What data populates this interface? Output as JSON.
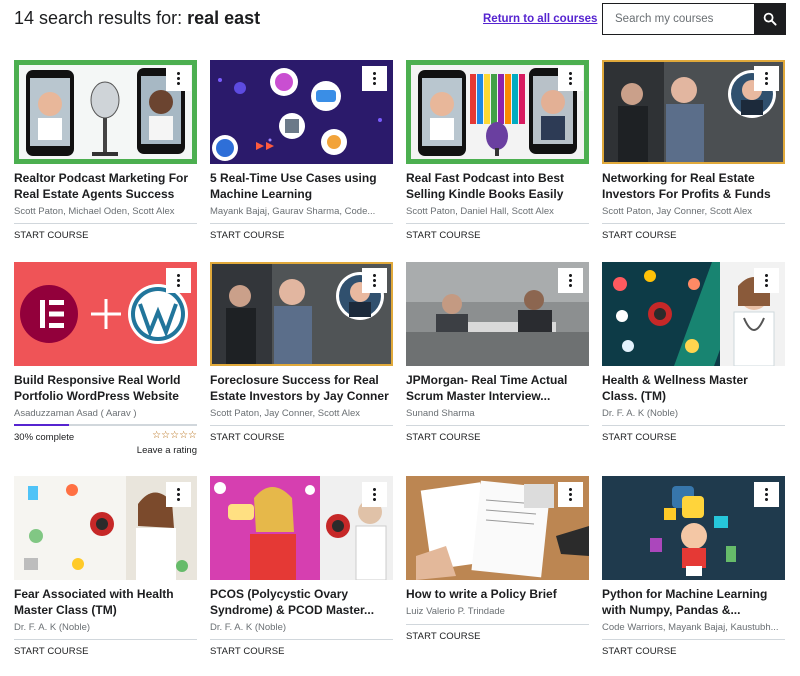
{
  "header": {
    "results_prefix": "14 search results for:",
    "query": "real east",
    "return_link": "Return to all courses",
    "search_placeholder": "Search my courses"
  },
  "colors": {
    "accent": "#5624d0",
    "text": "#1c1d1f",
    "muted": "#6a6f73",
    "star": "#b4690e"
  },
  "courses": [
    {
      "title_l1": "Realtor Podcast Marketing For",
      "title_l2": "Real Estate Agents Success",
      "authors": "Scott Paton, Michael Oden, Scott Alex",
      "action": "START COURSE"
    },
    {
      "title_l1": "5 Real-Time Use Cases using",
      "title_l2": "Machine Learning",
      "authors": "Mayank Bajaj, Gaurav Sharma, Code...",
      "action": "START COURSE"
    },
    {
      "title_l1": "Real Fast Podcast into Best",
      "title_l2": "Selling Kindle Books Easily",
      "authors": "Scott Paton, Daniel Hall, Scott Alex",
      "action": "START COURSE"
    },
    {
      "title_l1": "Networking for Real Estate",
      "title_l2": "Investors For Profits & Funds",
      "authors": "Scott Paton, Jay Conner, Scott Alex",
      "action": "START COURSE"
    },
    {
      "title_l1": "Build Responsive Real World",
      "title_l2": "Portfolio WordPress Website",
      "authors": "Asaduzzaman Asad ( Aarav )",
      "progress_text": "30% complete",
      "progress": 0.3,
      "stars": "☆☆☆☆☆",
      "rating_link": "Leave a rating"
    },
    {
      "title_l1": "Foreclosure Success for Real",
      "title_l2": "Estate Investors by Jay Conner",
      "authors": "Scott Paton, Jay Conner, Scott Alex",
      "action": "START COURSE"
    },
    {
      "title_l1": "JPMorgan- Real Time Actual",
      "title_l2": "Scrum Master Interview...",
      "authors": "Sunand Sharma",
      "action": "START COURSE"
    },
    {
      "title_l1": "Health & Wellness Master",
      "title_l2": "Class. (TM)",
      "authors": "Dr. F. A. K (Noble)",
      "action": "START COURSE"
    },
    {
      "title_l1": "Fear Associated with Health",
      "title_l2": "Master Class (TM)",
      "authors": "Dr. F. A. K (Noble)",
      "action": "START COURSE"
    },
    {
      "title_l1": "PCOS (Polycystic Ovary",
      "title_l2": "Syndrome) & PCOD Master...",
      "authors": "Dr. F. A. K (Noble)",
      "action": "START COURSE"
    },
    {
      "title_l1": "How to write a Policy Brief",
      "title_l2": "",
      "authors": "Luiz Valerio P. Trindade",
      "action": "START COURSE"
    },
    {
      "title_l1": "Python for Machine Learning",
      "title_l2": "with Numpy, Pandas &...",
      "authors": "Code Warriors, Mayank Bajaj, Kaustubh...",
      "action": "START COURSE"
    }
  ]
}
